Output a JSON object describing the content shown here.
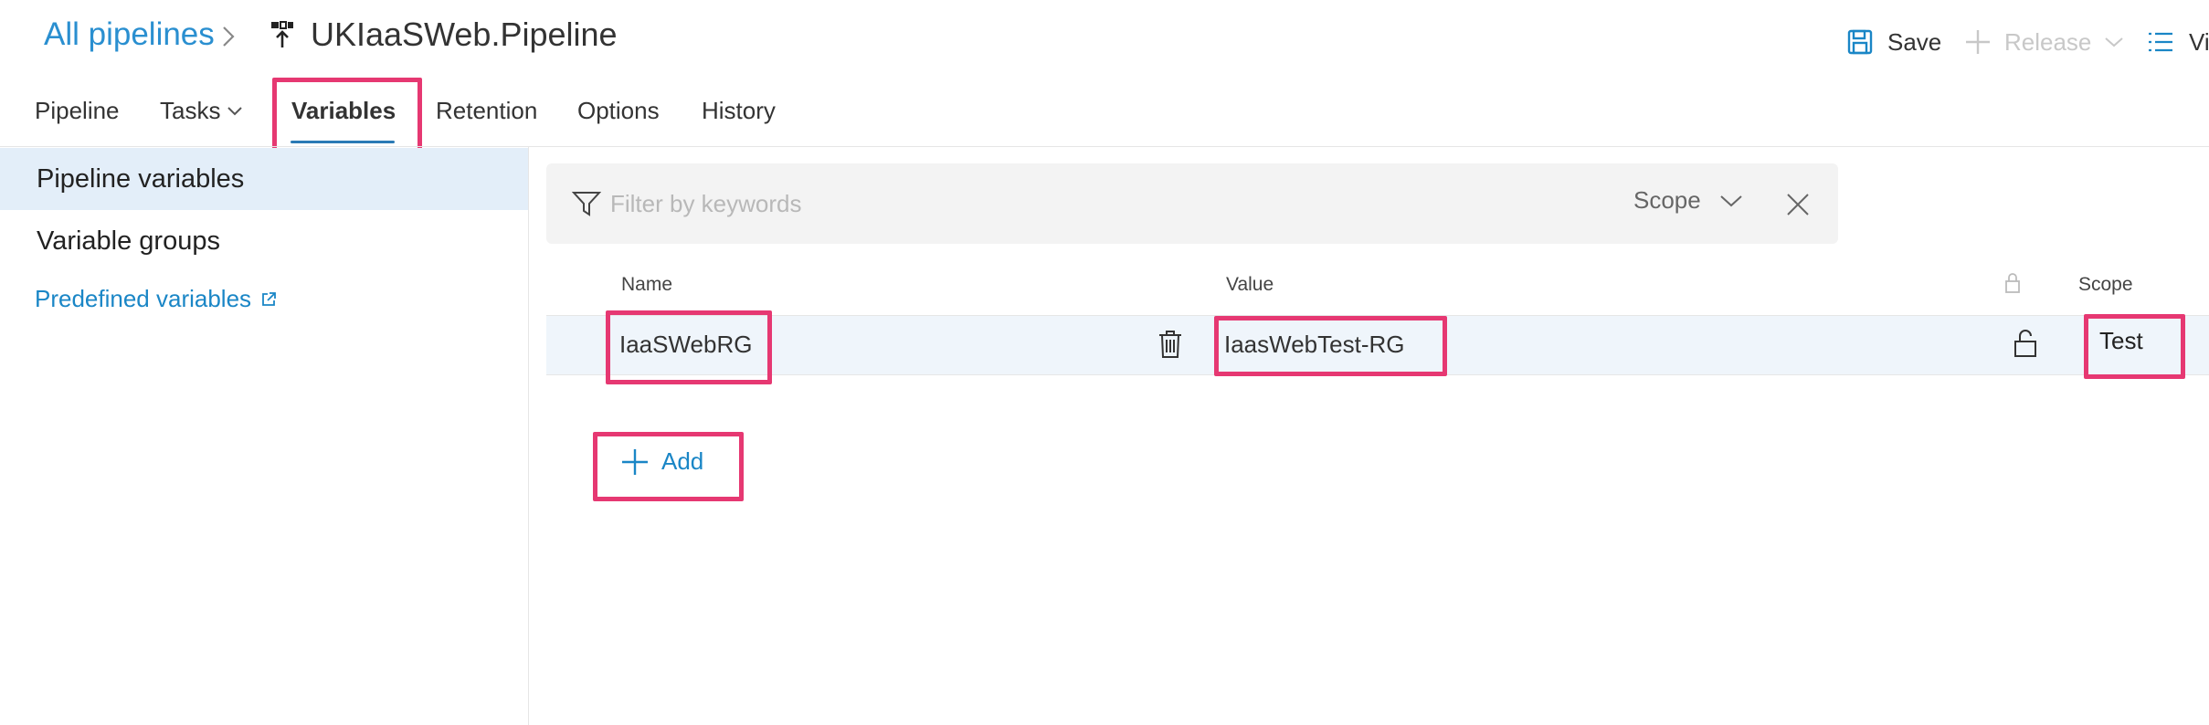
{
  "breadcrumb": {
    "root_label": "All pipelines",
    "pipeline_name": "UKIaaSWeb.Pipeline"
  },
  "commands": {
    "save_label": "Save",
    "release_label": "Release",
    "view_label": "Vi"
  },
  "tabs": [
    {
      "label": "Pipeline"
    },
    {
      "label": "Tasks"
    },
    {
      "label": "Variables",
      "active": true
    },
    {
      "label": "Retention"
    },
    {
      "label": "Options"
    },
    {
      "label": "History"
    }
  ],
  "left_nav": {
    "items": [
      {
        "label": "Pipeline variables",
        "selected": true
      },
      {
        "label": "Variable groups"
      }
    ],
    "predefined_link": "Predefined variables"
  },
  "filter": {
    "placeholder": "Filter by keywords",
    "scope_label": "Scope"
  },
  "table": {
    "headers": {
      "name": "Name",
      "value": "Value",
      "scope": "Scope"
    },
    "rows": [
      {
        "name": "IaaSWebRG",
        "value": "IaasWebTest-RG",
        "scope": "Test"
      }
    ]
  },
  "add_label": "Add",
  "colors": {
    "accent": "#1a86c6",
    "breadcrumb_link": "#2a8fd0",
    "highlight": "#e63872",
    "selected_bg": "#e3eef9",
    "row_bg": "#eff5fb"
  }
}
